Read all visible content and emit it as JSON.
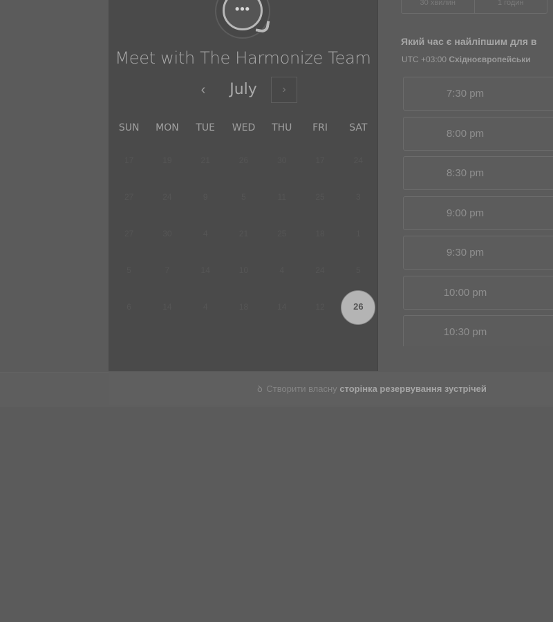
{
  "calendar_panel": {
    "team_title": "Meet with The Harmonize Team",
    "avatar_icon": "chat-dots-icon",
    "month": "July",
    "prev_icon": "chevron-left-icon",
    "next_icon": "chevron-right-icon",
    "weekdays": [
      "SUN",
      "MON",
      "TUE",
      "WED",
      "THU",
      "FRI",
      "SAT"
    ],
    "weeks": [
      [
        "17",
        "19",
        "21",
        "26",
        "30",
        "17",
        "24"
      ],
      [
        "27",
        "24",
        "9",
        "5",
        "11",
        "25",
        "3"
      ],
      [
        "27",
        "30",
        "4",
        "21",
        "25",
        "18",
        "1"
      ],
      [
        "5",
        "7",
        "14",
        "10",
        "4",
        "24",
        "5"
      ],
      [
        "6",
        "14",
        "4",
        "18",
        "14",
        "12",
        "26"
      ]
    ],
    "selected_day": "26"
  },
  "durations": [
    "30 хвилин",
    "1 годин"
  ],
  "question": "Який час є найліпшим для в",
  "timezone": {
    "offset": "UTC +03:00",
    "name": "Східноєвропейськи"
  },
  "time_slots": [
    "7:30 pm",
    "8:00 pm",
    "8:30 pm",
    "9:00 pm",
    "9:30 pm",
    "10:00 pm",
    "10:30 pm"
  ],
  "footer": {
    "icon": "hubspot-sprocket-icon",
    "prefix": "Створити власну",
    "link": "сторінка резервування зустрічей"
  }
}
